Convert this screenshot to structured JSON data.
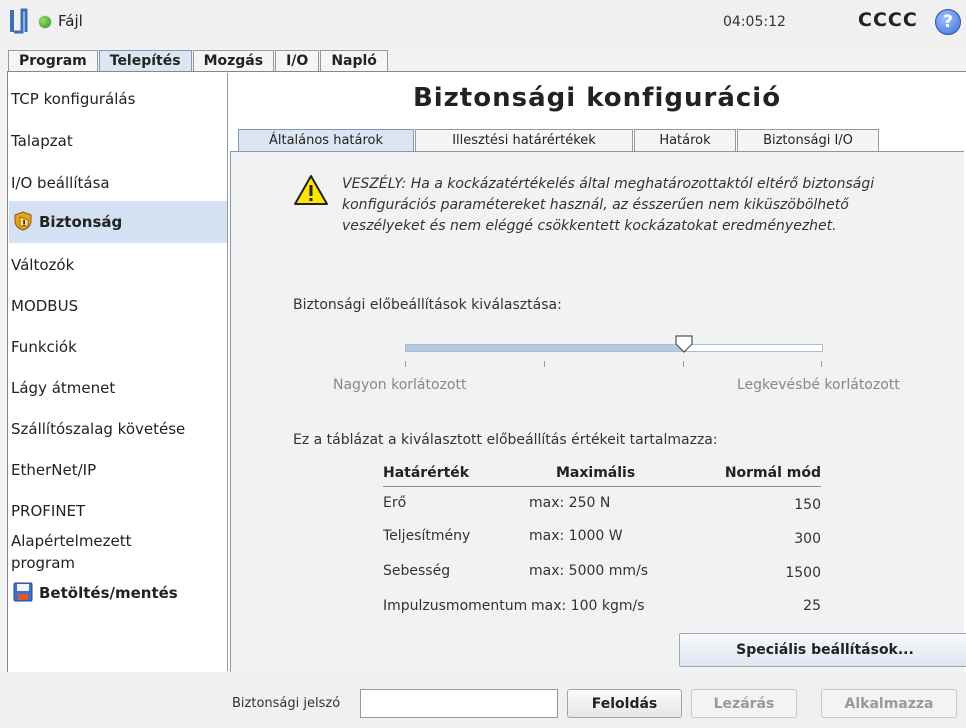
{
  "topbar": {
    "file_menu": "Fájl",
    "clock": "04:05:12",
    "robot_name": "CCCC",
    "help": "?"
  },
  "main_tabs": [
    "Program",
    "Telepítés",
    "Mozgás",
    "I/O",
    "Napló"
  ],
  "sidebar": {
    "items": [
      {
        "label": "TCP konfigurálás"
      },
      {
        "label": "Talapzat"
      },
      {
        "label": "I/O beállítása"
      },
      {
        "label": "Biztonság",
        "icon": "safety-shield-icon"
      },
      {
        "label": "Változók"
      },
      {
        "label": "MODBUS"
      },
      {
        "label": "Funkciók"
      },
      {
        "label": "Lágy átmenet"
      },
      {
        "label": "Szállítószalag követése"
      },
      {
        "label": "EtherNet/IP"
      },
      {
        "label": "PROFINET"
      },
      {
        "label": "Alapértelmezett program"
      },
      {
        "label": "Betöltés/mentés",
        "icon": "save-disk-icon"
      }
    ]
  },
  "page": {
    "title": "Biztonsági konfiguráció",
    "tabs": [
      "Általános határok",
      "Illesztési határértékek",
      "Határok",
      "Biztonsági I/O"
    ],
    "warning": "VESZÉLY: Ha a kockázatértékelés által meghatározottaktól eltérő biztonsági konfigurációs paramétereket használ, az ésszerűen nem kiküszöbölhető veszélyeket és nem eléggé csökkentett kockázatokat eredményezhet.",
    "preset_label": "Biztonsági előbeállítások kiválasztása:",
    "slider": {
      "value_fraction": 0.67,
      "min_label": "Nagyon korlátozott",
      "max_label": "Legkevésbé korlátozott"
    },
    "table_intro": "Ez a táblázat a kiválasztott előbeállítás értékeit tartalmazza:",
    "table": {
      "headers": [
        "Határérték",
        "Maximális",
        "Normál mód"
      ],
      "rows": [
        [
          "Erő",
          "max: 250 N",
          "150"
        ],
        [
          "Teljesítmény",
          "max: 1000 W",
          "300"
        ],
        [
          "Sebesség",
          "max: 5000 mm/s",
          "1500"
        ],
        [
          "Impulzusmomentum",
          "max: 100 kgm/s",
          "25"
        ]
      ]
    },
    "advanced_button": "Speciális beállítások..."
  },
  "footer": {
    "password_label": "Biztonsági jelszó",
    "password_value": "",
    "unlock": "Feloldás",
    "lock": "Lezárás",
    "apply": "Alkalmazza"
  },
  "colors": {
    "accent": "#d3e1f3",
    "panel": "#f2f2f2"
  }
}
